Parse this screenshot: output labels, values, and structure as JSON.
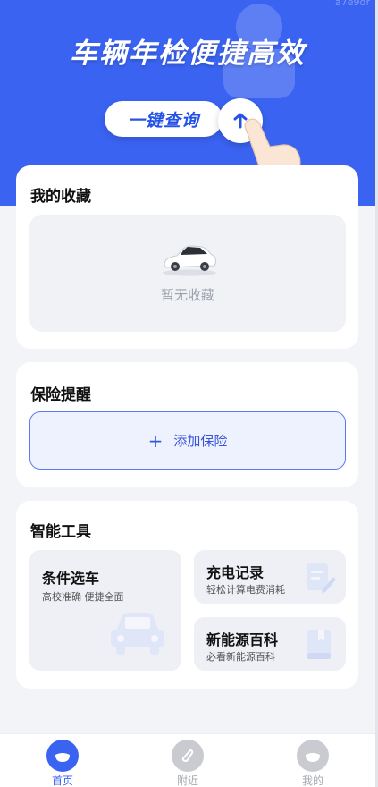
{
  "hero": {
    "title": "车辆年检便捷高效",
    "query_label": "一键查询",
    "watermark": "a7e9dr"
  },
  "favorites": {
    "title": "我的收藏",
    "empty_text": "暂无收藏"
  },
  "insurance": {
    "title": "保险提醒",
    "add_label": "添加保险",
    "add_icon": "plus-icon"
  },
  "tools": {
    "title": "智能工具",
    "items": [
      {
        "title": "条件选车",
        "subtitle": "高校准确 便捷全面",
        "icon": "car-icon"
      },
      {
        "title": "充电记录",
        "subtitle": "轻松计算电费消耗",
        "icon": "document-edit-icon"
      },
      {
        "title": "新能源百科",
        "subtitle": "必看新能源百科",
        "icon": "book-icon"
      }
    ]
  },
  "tabbar": {
    "items": [
      {
        "label": "首页",
        "icon": "home-icon",
        "active": true
      },
      {
        "label": "附近",
        "icon": "compass-icon",
        "active": false
      },
      {
        "label": "我的",
        "icon": "profile-icon",
        "active": false
      }
    ],
    "active_color": "#3a63f2",
    "inactive_color": "#a7a9b0"
  },
  "colors": {
    "brand": "#3a63f2",
    "page_bg": "#f3f4f8"
  }
}
